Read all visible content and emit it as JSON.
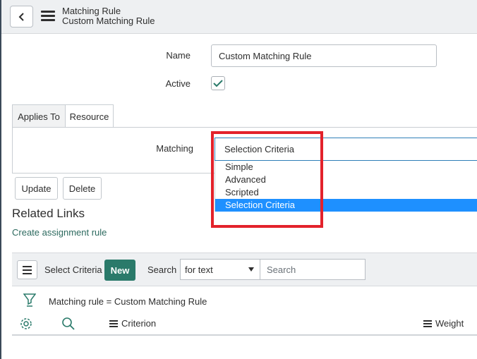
{
  "header": {
    "title": "Matching Rule",
    "subtitle": "Custom Matching Rule"
  },
  "form": {
    "name_label": "Name",
    "name_value": "Custom Matching Rule",
    "active_label": "Active",
    "active_checked": true
  },
  "tabs": [
    {
      "label": "Applies To"
    },
    {
      "label": "Resource"
    }
  ],
  "matching": {
    "label": "Matching",
    "selected": "Selection Criteria",
    "options": [
      "Simple",
      "Advanced",
      "Scripted",
      "Selection Criteria"
    ]
  },
  "buttons": {
    "update": "Update",
    "delete": "Delete"
  },
  "related": {
    "title": "Related Links",
    "link": "Create assignment rule"
  },
  "list": {
    "title": "Select Criteria",
    "new_label": "New",
    "search_label": "Search",
    "search_type": "for text",
    "search_placeholder": "Search",
    "filter": "Matching rule = Custom Matching Rule",
    "columns": [
      "Criterion",
      "Weight"
    ]
  },
  "colors": {
    "accent": "#2a7a6a",
    "selected_option": "#1e90ff",
    "highlight": "#e3222b"
  }
}
